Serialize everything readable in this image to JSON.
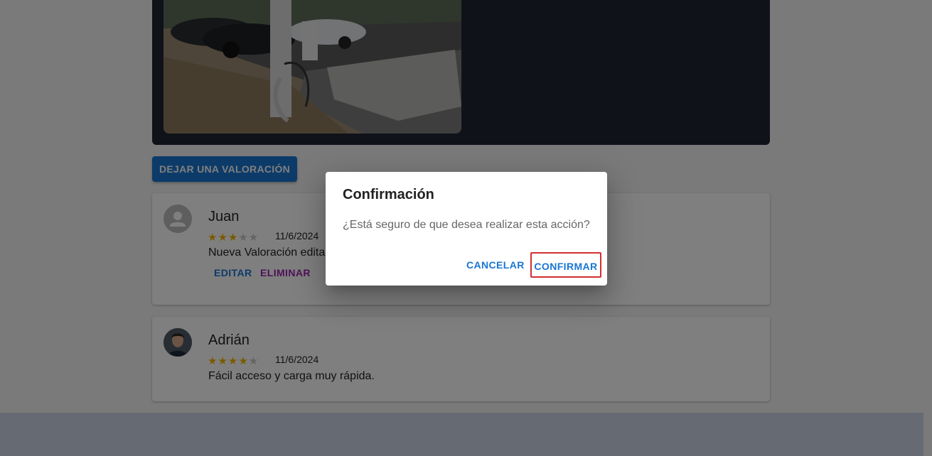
{
  "actions": {
    "leave_review": "DEJAR UNA VALORACIÓN"
  },
  "reviews": [
    {
      "name": "Juan",
      "rating": 3,
      "max_rating": 5,
      "stars_on": "★★★",
      "stars_off": "★★",
      "date": "11/6/2024",
      "comment": "Nueva Valoración edita",
      "edit_label": "EDITAR",
      "delete_label": "ELIMINAR"
    },
    {
      "name": "Adrián",
      "rating": 4,
      "max_rating": 5,
      "stars_on": "★★★★",
      "stars_off": "★",
      "date": "11/6/2024",
      "comment": "Fácil acceso y carga muy rápida."
    }
  ],
  "dialog": {
    "title": "Confirmación",
    "message": "¿Está seguro de que desea realizar esta acción?",
    "cancel_label": "CANCELAR",
    "confirm_label": "CONFIRMAR"
  },
  "colors": {
    "primary": "#1976d2",
    "secondary": "#9c27b0",
    "star": "#f5b400",
    "highlight": "#d32f2f",
    "hero_background": "#1e2533"
  }
}
